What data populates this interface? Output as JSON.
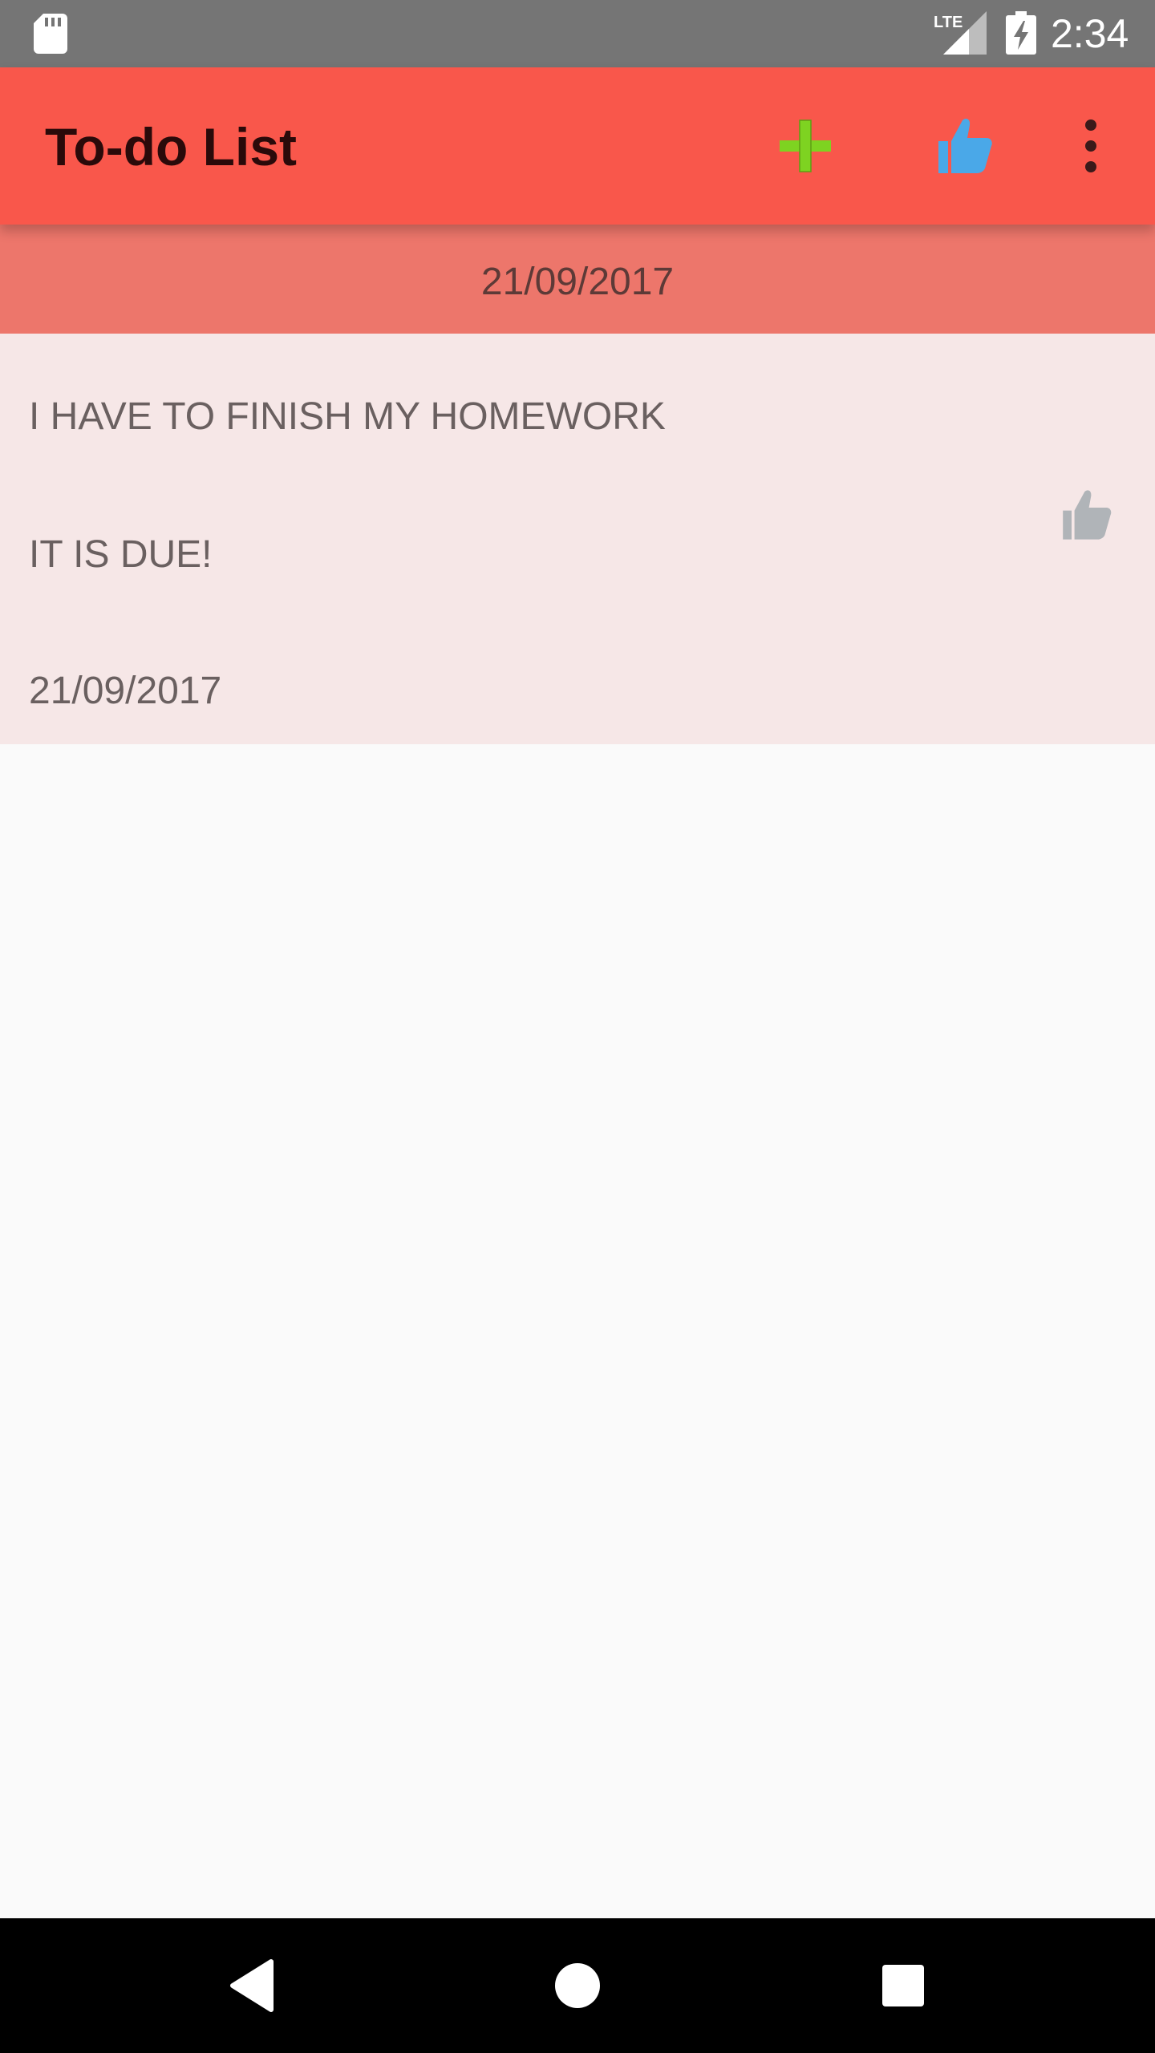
{
  "status_bar": {
    "time": "2:34",
    "network_label": "LTE",
    "icons": [
      "sd-card-icon",
      "lte-signal-icon",
      "battery-charging-icon"
    ]
  },
  "app_bar": {
    "title": "To-do List",
    "actions": [
      "add-icon",
      "thumbs-up-icon",
      "more-vert-icon"
    ],
    "colors": {
      "background": "#f9574b",
      "add": "#7ed321",
      "like": "#4aa8e8"
    }
  },
  "list": {
    "section_date": "21/09/2017",
    "items": [
      {
        "title": "I HAVE TO FINISH MY HOMEWORK",
        "note": "IT IS DUE!",
        "date": "21/09/2017",
        "icon": "thumbs-up-icon"
      }
    ]
  },
  "nav_bar": {
    "buttons": [
      "back-icon",
      "home-icon",
      "recents-icon"
    ]
  }
}
